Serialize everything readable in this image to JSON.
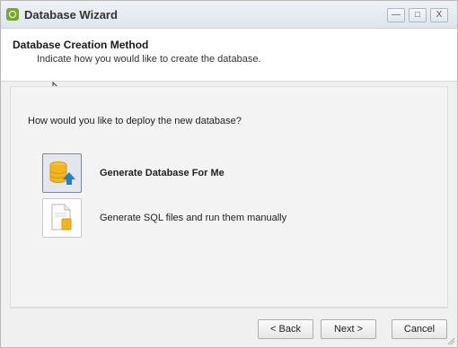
{
  "window": {
    "title": "Database Wizard",
    "minimize_label": "—",
    "maximize_label": "□",
    "close_label": "X"
  },
  "header": {
    "title": "Database Creation Method",
    "subtitle": "Indicate how you would like to create the database."
  },
  "main": {
    "question": "How would you like to deploy the new database?",
    "options": [
      {
        "label": "Generate Database For Me",
        "icon": "database-upload-icon",
        "selected": true
      },
      {
        "label": "Generate SQL files and run them manually",
        "icon": "sql-file-icon",
        "selected": false
      }
    ]
  },
  "footer": {
    "back_label": "< Back",
    "next_label": "Next >",
    "cancel_label": "Cancel"
  },
  "colors": {
    "accent": "#1e7fd6",
    "db_yellow": "#f2b51e",
    "app_icon": "#7aa82a"
  }
}
